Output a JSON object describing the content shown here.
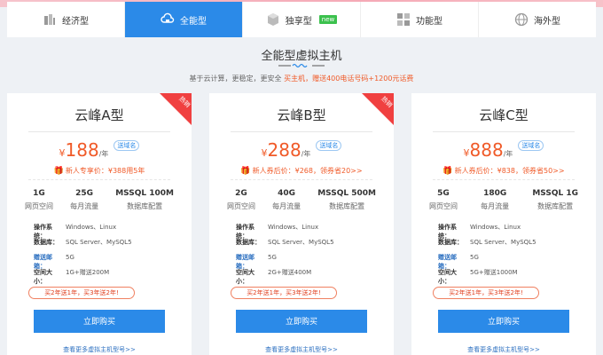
{
  "tabs": [
    {
      "label": "经济型",
      "icon": "server-icon"
    },
    {
      "label": "全能型",
      "icon": "cloud-box-icon",
      "active": true
    },
    {
      "label": "独享型",
      "icon": "cube-icon",
      "badge": "new"
    },
    {
      "label": "功能型",
      "icon": "grid-icon"
    },
    {
      "label": "海外型",
      "icon": "globe-icon"
    }
  ],
  "section": {
    "title": "全能型虚拟主机",
    "subtitle_plain": "基于云计算，更稳定，更安全 ",
    "subtitle_highlight": "买主机，赠送400电话号码+1200元话费"
  },
  "cards": [
    {
      "name": "云峰A型",
      "ribbon": "热销",
      "currency": "¥",
      "price": "188",
      "per": "/年",
      "domain_badge": "送域名",
      "promo": "新人专享价：¥388用5年",
      "specs": [
        {
          "value": "1G",
          "label": "网页空间"
        },
        {
          "value": "25G",
          "label": "每月流量"
        },
        {
          "value": "MSSQL 100M",
          "label": "数据库配置"
        }
      ],
      "details": [
        {
          "key": "操作系统：",
          "value": "Windows、Linux"
        },
        {
          "key": "数据库：",
          "value": "SQL Server、MySQL5"
        },
        {
          "key": "赠送邮箱：",
          "value": "5G"
        },
        {
          "key": "空间大小：",
          "value": "1G+赠送200M"
        }
      ],
      "offer": "买2年送1年，买3年送2年!",
      "buy_label": "立即购买",
      "more_label": "查看更多虚拟主机型号>>"
    },
    {
      "name": "云峰B型",
      "ribbon": "热销",
      "currency": "¥",
      "price": "288",
      "per": "/年",
      "domain_badge": "送域名",
      "promo": "新人券后价：¥268，领券省20>>",
      "specs": [
        {
          "value": "2G",
          "label": "网页空间"
        },
        {
          "value": "40G",
          "label": "每月流量"
        },
        {
          "value": "MSSQL 500M",
          "label": "数据库配置"
        }
      ],
      "details": [
        {
          "key": "操作系统：",
          "value": "Windows、Linux"
        },
        {
          "key": "数据库：",
          "value": "SQL Server、MySQL5"
        },
        {
          "key": "赠送邮箱：",
          "value": "5G"
        },
        {
          "key": "空间大小：",
          "value": "2G+赠送400M"
        }
      ],
      "offer": "买2年送1年，买3年送2年!",
      "buy_label": "立即购买",
      "more_label": "查看更多虚拟主机型号>>"
    },
    {
      "name": "云峰C型",
      "ribbon": "",
      "currency": "¥",
      "price": "888",
      "per": "/年",
      "domain_badge": "送域名",
      "promo": "新人券后价：¥838，领券省50>>",
      "specs": [
        {
          "value": "5G",
          "label": "网页空间"
        },
        {
          "value": "180G",
          "label": "每月流量"
        },
        {
          "value": "MSSQL 1G",
          "label": "数据库配置"
        }
      ],
      "details": [
        {
          "key": "操作系统：",
          "value": "Windows、Linux"
        },
        {
          "key": "数据库：",
          "value": "SQL Server、MySQL5"
        },
        {
          "key": "赠送邮箱：",
          "value": "5G"
        },
        {
          "key": "空间大小：",
          "value": "5G+赠送1000M"
        }
      ],
      "offer": "买2年送1年，买3年送2年!",
      "buy_label": "立即购买",
      "more_label": "查看更多虚拟主机型号>>"
    }
  ],
  "colors": {
    "accent": "#2b8ae8",
    "price": "#f05a28",
    "ribbon": "#f04040",
    "new": "#3cc14e"
  }
}
